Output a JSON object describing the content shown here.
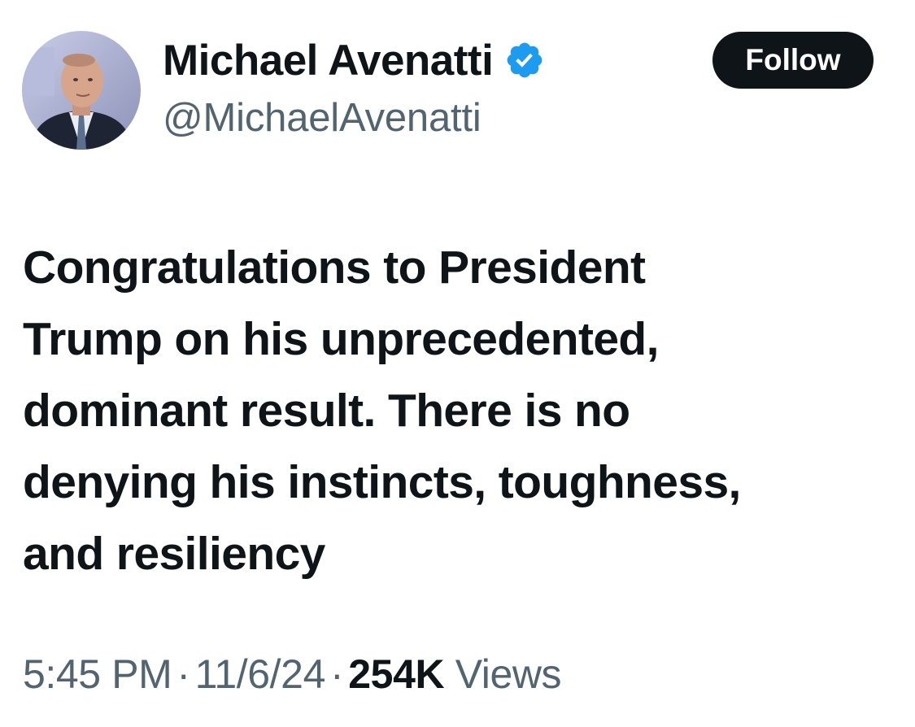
{
  "author": {
    "display_name": "Michael Avenatti",
    "handle": "@MichaelAvenatti",
    "verified": true,
    "avatar_icon": "profile-photo"
  },
  "follow_button": {
    "label": "Follow"
  },
  "tweet": {
    "lines": [
      "Congratulations to President",
      "Trump on his unprecedented,",
      "dominant result. There is no",
      "denying his instincts, toughness,",
      "and resiliency"
    ]
  },
  "meta": {
    "time": "5:45 PM",
    "separator": "·",
    "date": "11/6/24",
    "views_count": "254K",
    "views_label": "Views"
  },
  "colors": {
    "text_primary": "#0f1419",
    "text_secondary": "#536471",
    "verified_blue": "#1d9bf0",
    "button_bg": "#0f1419"
  }
}
